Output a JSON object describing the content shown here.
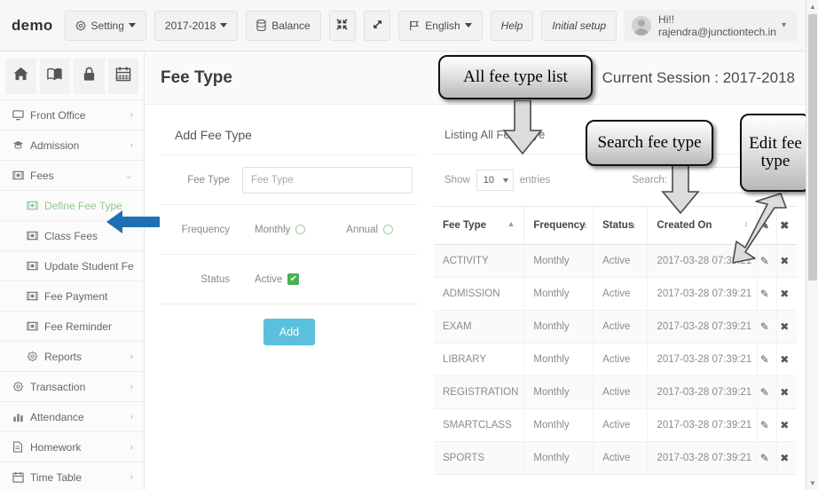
{
  "topbar": {
    "brand": "demo",
    "buttons": [
      {
        "label": "Setting",
        "icon": "gear-icon",
        "caret": true
      },
      {
        "label": "2017-2018",
        "icon": "",
        "caret": true
      },
      {
        "label": "Balance",
        "icon": "database-icon",
        "caret": false
      },
      {
        "label": "",
        "icon": "compress-icon",
        "caret": false
      },
      {
        "label": "",
        "icon": "expand-icon",
        "caret": false
      },
      {
        "label": "English",
        "icon": "flag-icon",
        "caret": true
      },
      {
        "label": "Help",
        "icon": "",
        "caret": false
      },
      {
        "label": "Initial setup",
        "icon": "",
        "caret": false
      }
    ],
    "user": "Hi!! rajendra@junctiontech.in"
  },
  "sidebar": {
    "quick_icons": [
      "home-icon",
      "book-icon",
      "lock-icon",
      "calendar-icon"
    ],
    "items": [
      {
        "label": "Front Office",
        "icon": "monitor-icon",
        "arrow": "›",
        "sub": false,
        "active": false
      },
      {
        "label": "Admission",
        "icon": "graduation-cap-icon",
        "arrow": "›",
        "sub": false,
        "active": false
      },
      {
        "label": "Fees",
        "icon": "money-icon",
        "arrow": "⌄",
        "sub": false,
        "active": false
      },
      {
        "label": "Define Fee Type",
        "icon": "money-icon",
        "arrow": "",
        "sub": true,
        "active": true
      },
      {
        "label": "Class Fees",
        "icon": "money-icon",
        "arrow": "",
        "sub": true,
        "active": false
      },
      {
        "label": "Update Student Fees",
        "icon": "money-icon",
        "arrow": "",
        "sub": true,
        "active": false
      },
      {
        "label": "Fee Payment",
        "icon": "money-icon",
        "arrow": "",
        "sub": true,
        "active": false
      },
      {
        "label": "Fee Reminder",
        "icon": "money-icon",
        "arrow": "",
        "sub": true,
        "active": false
      },
      {
        "label": "Reports",
        "icon": "gear-icon",
        "arrow": "›",
        "sub": true,
        "active": false
      },
      {
        "label": "Transaction",
        "icon": "gear-icon",
        "arrow": "›",
        "sub": false,
        "active": false
      },
      {
        "label": "Attendance",
        "icon": "chart-icon",
        "arrow": "›",
        "sub": false,
        "active": false
      },
      {
        "label": "Homework",
        "icon": "document-icon",
        "arrow": "›",
        "sub": false,
        "active": false
      },
      {
        "label": "Time Table",
        "icon": "calendar-icon",
        "arrow": "›",
        "sub": false,
        "active": false
      }
    ]
  },
  "page": {
    "title": "Fee Type",
    "session": "Current Session : 2017-2018"
  },
  "form": {
    "title": "Add Fee Type",
    "fee_type_label": "Fee Type",
    "fee_type_value": "",
    "fee_type_placeholder": "Fee Type",
    "frequency_label": "Frequency",
    "frequency_options": [
      "Monthly",
      "Annual"
    ],
    "status_label": "Status",
    "status_option": "Active",
    "status_checked": "✔",
    "submit_label": "Add"
  },
  "listing": {
    "title": "Listing All Fee Tpye",
    "show_label": "Show",
    "entries_value": "10",
    "entries_label": "entries",
    "search_label": "Search:",
    "search_value": "",
    "columns": [
      {
        "label": "Fee Type",
        "sort": "asc"
      },
      {
        "label": "Frequency",
        "sort": "none"
      },
      {
        "label": "Status",
        "sort": "none"
      },
      {
        "label": "Created On",
        "sort": "both"
      },
      {
        "label": "edit-column-icon",
        "sort": ""
      },
      {
        "label": "delete-column-icon",
        "sort": ""
      }
    ],
    "rows": [
      {
        "fee_type": "ACTIVITY",
        "frequency": "Monthly",
        "status": "Active",
        "created_on": "2017-03-28 07:39:21"
      },
      {
        "fee_type": "ADMISSION",
        "frequency": "Monthly",
        "status": "Active",
        "created_on": "2017-03-28 07:39:21"
      },
      {
        "fee_type": "EXAM",
        "frequency": "Monthly",
        "status": "Active",
        "created_on": "2017-03-28 07:39:21"
      },
      {
        "fee_type": "LIBRARY",
        "frequency": "Monthly",
        "status": "Active",
        "created_on": "2017-03-28 07:39:21"
      },
      {
        "fee_type": "REGISTRATION",
        "frequency": "Monthly",
        "status": "Active",
        "created_on": "2017-03-28 07:39:21"
      },
      {
        "fee_type": "SMARTCLASS",
        "frequency": "Monthly",
        "status": "Active",
        "created_on": "2017-03-28 07:39:21"
      },
      {
        "fee_type": "SPORTS",
        "frequency": "Monthly",
        "status": "Active",
        "created_on": "2017-03-28 07:39:21"
      }
    ]
  },
  "annotations": {
    "all_fee_type_list": "All fee type list",
    "search_fee_type": "Search fee type",
    "edit_fee_type": "Edit fee type"
  },
  "colors": {
    "accent_blue": "#5bc0de",
    "arrow_blue": "#1f6fb2",
    "active_green": "#8ec98e",
    "check_green": "#4caf50"
  }
}
